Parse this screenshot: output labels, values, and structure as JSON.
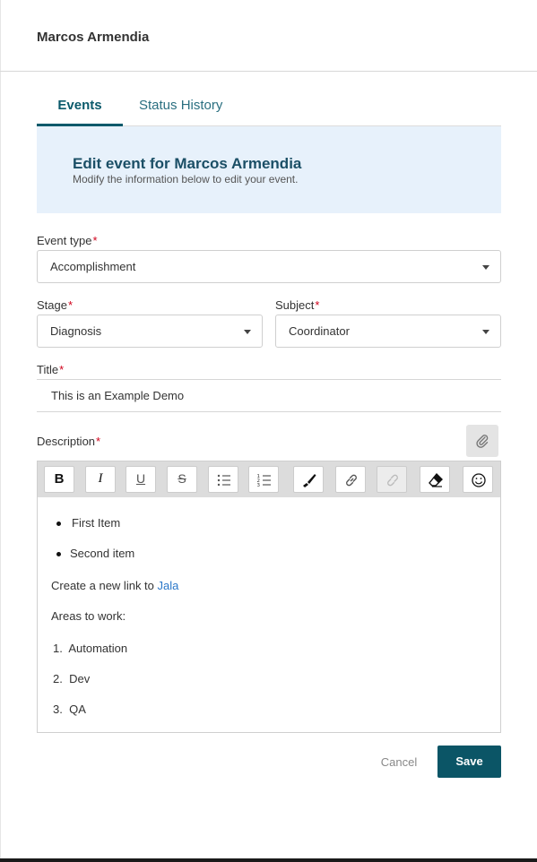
{
  "header": {
    "name": "Marcos Armendia"
  },
  "tabs": [
    {
      "label": "Events"
    },
    {
      "label": "Status History"
    }
  ],
  "banner": {
    "title": "Edit event for Marcos Armendia",
    "subtitle": "Modify the information below to edit your event."
  },
  "form": {
    "event_type": {
      "label": "Event type",
      "value": "Accomplishment"
    },
    "stage": {
      "label": "Stage",
      "value": "Diagnosis"
    },
    "subject": {
      "label": "Subject",
      "value": "Coordinator"
    },
    "title": {
      "label": "Title",
      "value": "This is an Example Demo"
    },
    "description": {
      "label": "Description"
    },
    "required_mark": "*"
  },
  "toolbar": {
    "bold": "B",
    "italic": "I",
    "underline": "U",
    "strike": "S",
    "icons": [
      "bullet-list-icon",
      "numbered-list-icon",
      "brush-icon",
      "link-icon",
      "unlink-icon",
      "eraser-icon",
      "emoji-icon"
    ]
  },
  "editor": {
    "bullets": [
      "First Item",
      "Second item"
    ],
    "link_line": {
      "prefix": "Create a new link to ",
      "link_text": "Jala"
    },
    "areas_label": "Areas to work:",
    "numbered": [
      {
        "n": "1.",
        "text": "Automation"
      },
      {
        "n": "2.",
        "text": "Dev"
      },
      {
        "n": "3.",
        "text": "QA"
      }
    ]
  },
  "actions": {
    "cancel": "Cancel",
    "save": "Save"
  },
  "colors": {
    "accent": "#0b5566",
    "banner_bg": "#e7f1fb",
    "link": "#2a77c9",
    "required": "#d0021b"
  }
}
